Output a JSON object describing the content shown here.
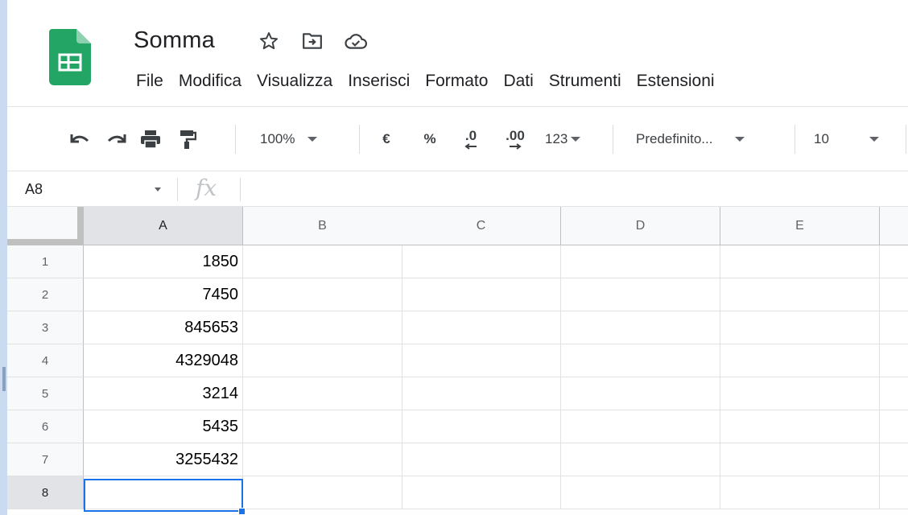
{
  "document": {
    "title": "Somma",
    "title_icons": [
      "star-icon",
      "move-to-folder-icon",
      "cloud-saved-icon"
    ]
  },
  "menu": [
    "File",
    "Modifica",
    "Visualizza",
    "Inserisci",
    "Formato",
    "Dati",
    "Strumenti",
    "Estensioni"
  ],
  "toolbar": {
    "undo_icon": "undo-icon",
    "redo_icon": "redo-icon",
    "print_icon": "print-icon",
    "paint_format_icon": "paint-format-icon",
    "zoom": "100%",
    "currency": "€",
    "percent": "%",
    "decrease_decimals": ".0",
    "increase_decimals": ".00",
    "number_format": "123",
    "font": "Predefinito...",
    "font_size": "10"
  },
  "formula_bar": {
    "name_box": "A8",
    "fx_label": "fx",
    "value": ""
  },
  "columns": [
    "A",
    "B",
    "C",
    "D",
    "E"
  ],
  "rows": [
    {
      "num": "1",
      "A": "1850"
    },
    {
      "num": "2",
      "A": "7450"
    },
    {
      "num": "3",
      "A": "845653"
    },
    {
      "num": "4",
      "A": "4329048"
    },
    {
      "num": "5",
      "A": "3214"
    },
    {
      "num": "6",
      "A": "5435"
    },
    {
      "num": "7",
      "A": "3255432"
    },
    {
      "num": "8",
      "A": ""
    }
  ],
  "selected_cell": "A8",
  "colors": {
    "sheets_green": "#23a566",
    "selection_blue": "#1a73e8"
  }
}
